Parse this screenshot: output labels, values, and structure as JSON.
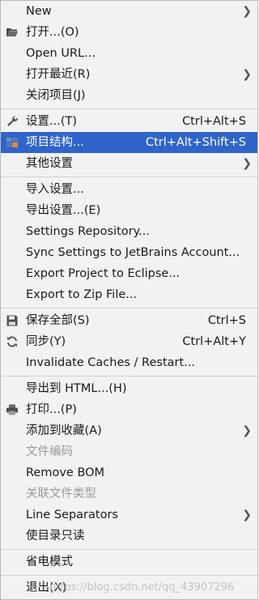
{
  "menu": {
    "new": {
      "label": "New"
    },
    "open": {
      "label": "打开...(O)"
    },
    "open_url": {
      "label": "Open URL..."
    },
    "open_recent": {
      "label": "打开最近(R)"
    },
    "close_project": {
      "label": "关闭项目(J)"
    },
    "settings": {
      "label": "设置...(T)",
      "shortcut": "Ctrl+Alt+S"
    },
    "project_structure": {
      "label": "项目结构...",
      "shortcut": "Ctrl+Alt+Shift+S"
    },
    "other_settings": {
      "label": "其他设置"
    },
    "import_settings": {
      "label": "导入设置..."
    },
    "export_settings": {
      "label": "导出设置...(E)"
    },
    "settings_repository": {
      "label": "Settings Repository..."
    },
    "sync_settings": {
      "label": "Sync Settings to JetBrains Account..."
    },
    "export_eclipse": {
      "label": "Export Project to Eclipse..."
    },
    "export_zip": {
      "label": "Export to Zip File..."
    },
    "save_all": {
      "label": "保存全部(S)",
      "shortcut": "Ctrl+S"
    },
    "sync": {
      "label": "同步(Y)",
      "shortcut": "Ctrl+Alt+Y"
    },
    "invalidate_caches": {
      "label": "Invalidate Caches / Restart..."
    },
    "export_html": {
      "label": "导出到 HTML...(H)"
    },
    "print": {
      "label": "打印...(P)"
    },
    "add_favorites": {
      "label": "添加到收藏(A)"
    },
    "file_encoding": {
      "label": "文件编码"
    },
    "remove_bom": {
      "label": "Remove BOM"
    },
    "associate_file_type": {
      "label": "关联文件类型"
    },
    "line_separators": {
      "label": "Line Separators"
    },
    "make_readonly": {
      "label": "使目录只读"
    },
    "power_save": {
      "label": "省电模式"
    },
    "exit": {
      "label": "退出(X)"
    }
  },
  "watermark": "https://blog.csdn.net/qq_43907296",
  "colors": {
    "selected_bg": "#2f65ca",
    "menu_bg": "#f2f2f2",
    "disabled_text": "#9b9b9b"
  },
  "icons": {
    "open": "folder-icon",
    "settings": "wrench-icon",
    "project_structure": "project-structure-icon",
    "save_all": "floppy-disk-icon",
    "sync": "sync-icon",
    "print": "printer-icon",
    "submenu": "chevron-right-icon"
  }
}
